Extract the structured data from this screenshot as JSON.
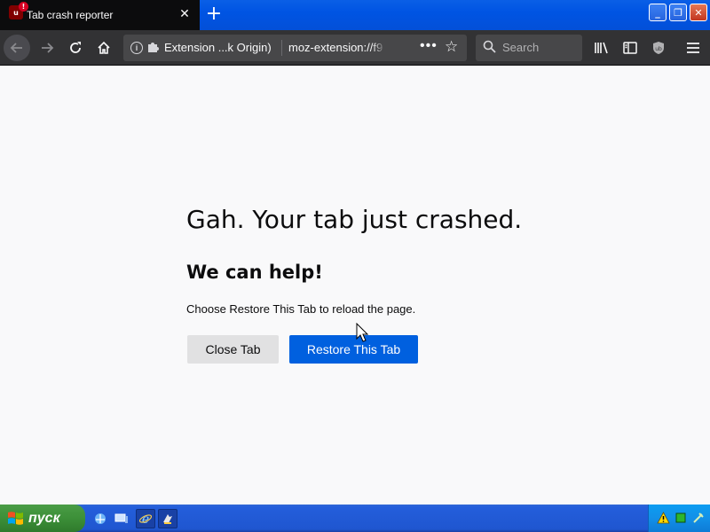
{
  "tab": {
    "title": "Tab crash reporter",
    "favicon_text": "u",
    "favicon_badge": "!",
    "close_glyph": "✕",
    "new_tab_glyph": "+"
  },
  "window_controls": {
    "minimize": "_",
    "restore": "❐",
    "close": "✕"
  },
  "toolbar": {
    "identity_label": "Extension ...k Origin)",
    "url": "moz-extension://f9",
    "page_actions": "•••",
    "search_placeholder": "Search"
  },
  "content": {
    "title": "Gah. Your tab just crashed.",
    "subtitle": "We can help!",
    "description": "Choose Restore This Tab to reload the page.",
    "close_tab_label": "Close Tab",
    "restore_tab_label": "Restore This Tab"
  },
  "taskbar": {
    "start_label": "пуск"
  },
  "colors": {
    "accent": "#0060df",
    "tab_bg": "#0c0c0d",
    "toolbar_bg": "#323234",
    "xp_blue": "#245edb",
    "xp_green": "#3c8f38"
  }
}
